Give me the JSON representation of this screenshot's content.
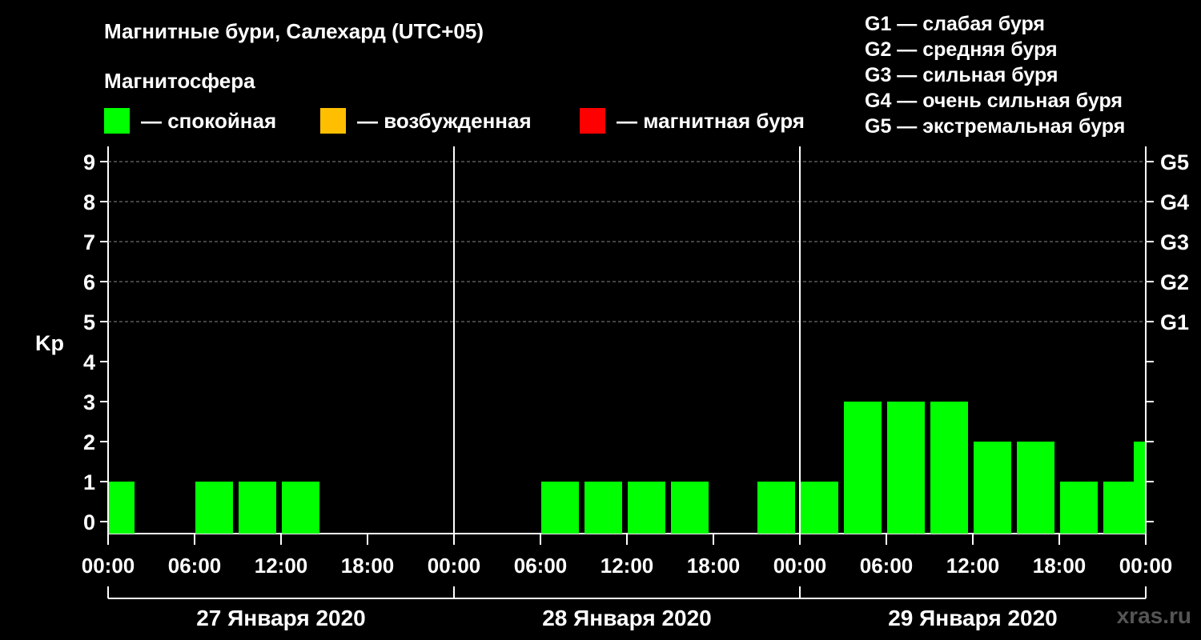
{
  "header": {
    "title": "Магнитные бури, Салехард (UTC+05)",
    "magnetosphere_label": "Магнитосфера"
  },
  "legend": [
    {
      "color": "#00ff00",
      "label": "— спокойная"
    },
    {
      "color": "#ffbf00",
      "label": "— возбужденная"
    },
    {
      "color": "#ff0000",
      "label": "— магнитная буря"
    }
  ],
  "g_legend": [
    "G1 — слабая буря",
    "G2 — средняя буря",
    "G3 — сильная буря",
    "G4 — очень сильная буря",
    "G5 — экстремальная буря"
  ],
  "watermark": "xras.ru",
  "chart_data": {
    "type": "bar",
    "title": "Магнитные бури, Салехард (UTC+05)",
    "ylabel": "Kp",
    "ylim": [
      0,
      9
    ],
    "y_ticks": [
      "0",
      "1",
      "2",
      "3",
      "4",
      "5",
      "6",
      "7",
      "8",
      "9"
    ],
    "right_axis_labels": [
      {
        "kp": 5,
        "label": "G1"
      },
      {
        "kp": 6,
        "label": "G2"
      },
      {
        "kp": 7,
        "label": "G3"
      },
      {
        "kp": 8,
        "label": "G4"
      },
      {
        "kp": 9,
        "label": "G5"
      }
    ],
    "grid": true,
    "x_tick_labels": [
      "00:00",
      "06:00",
      "12:00",
      "18:00",
      "00:00",
      "06:00",
      "12:00",
      "18:00",
      "00:00",
      "06:00",
      "12:00",
      "18:00",
      "00:00"
    ],
    "days": [
      "27 Января 2020",
      "28 Января 2020",
      "29 Января 2020"
    ],
    "bar_color": "#00ff00",
    "series": [
      {
        "values": [
          1,
          null,
          1,
          1,
          1,
          null,
          null,
          null,
          null,
          null,
          1,
          1,
          1,
          1,
          null,
          1,
          1,
          3,
          3,
          3,
          2,
          2,
          1,
          1
        ]
      }
    ],
    "partial_last_bar": {
      "value": 2
    }
  }
}
